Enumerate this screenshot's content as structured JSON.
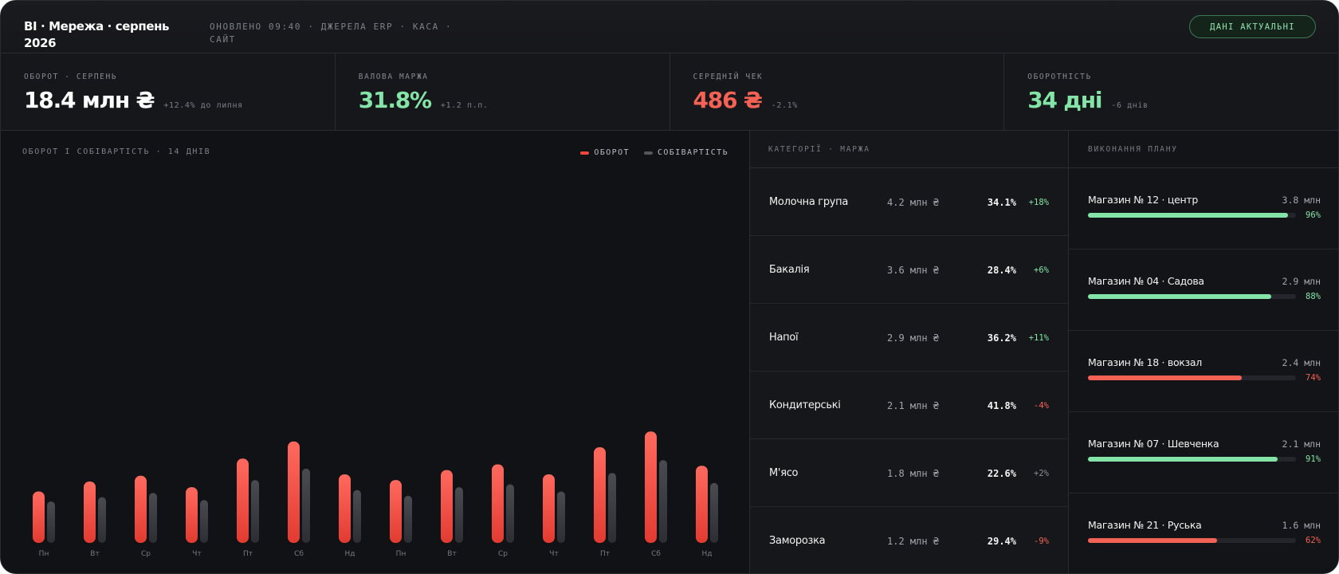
{
  "header": {
    "title": "BI · Мережа · серпень 2026",
    "updated": "ОНОВЛЕНО 09:40 · ДЖЕРЕЛА ERP · КАСА · САЙТ",
    "status": "ДАНІ АКТУАЛЬНІ"
  },
  "kpis": [
    {
      "label": "ОБОРОТ · СЕРПЕНЬ",
      "value": "18.4 млн ₴",
      "delta": "+12.4% до липня",
      "tone": "white"
    },
    {
      "label": "ВАЛОВА МАРЖА",
      "value": "31.8%",
      "delta": "+1.2 п.п.",
      "tone": "green"
    },
    {
      "label": "СЕРЕДНІЙ ЧЕК",
      "value": "486 ₴",
      "delta": "-2.1%",
      "tone": "red"
    },
    {
      "label": "ОБОРОТНІСТЬ",
      "value": "34 дні",
      "delta": "-6 днів",
      "tone": "green"
    }
  ],
  "chart": {
    "title": "ОБОРОТ І СОБІВАРТІСТЬ · 14 ДНІВ",
    "legend": {
      "revenue": "ОБОРОТ",
      "cost": "СОБІВАРТІСТЬ"
    }
  },
  "chart_data": {
    "type": "bar",
    "categories": [
      "Пн",
      "Вт",
      "Ср",
      "Чт",
      "Пт",
      "Сб",
      "Нд",
      "Пн",
      "Вт",
      "Ср",
      "Чт",
      "Пт",
      "Сб",
      "Нд"
    ],
    "series": [
      {
        "name": "ОБОРОТ",
        "color": "#f0473c",
        "values": [
          36,
          43,
          47,
          39,
          59,
          71,
          48,
          44,
          51,
          55,
          48,
          67,
          78,
          54
        ]
      },
      {
        "name": "СОБІВАРТІСТЬ",
        "color": "#3a3b40",
        "values": [
          29,
          32,
          35,
          30,
          44,
          52,
          37,
          33,
          39,
          41,
          36,
          49,
          58,
          42
        ]
      }
    ],
    "ylim": [
      0,
      240
    ],
    "grid": false,
    "legend_position": "top-right"
  },
  "categories": {
    "title": "КАТЕГОРІЇ · МАРЖА",
    "rows": [
      {
        "name": "Молочна група",
        "revenue": "4.2 млн ₴",
        "margin": "34.1%",
        "delta": "+18%",
        "tone": "green"
      },
      {
        "name": "Бакалія",
        "revenue": "3.6 млн ₴",
        "margin": "28.4%",
        "delta": "+6%",
        "tone": "green"
      },
      {
        "name": "Напої",
        "revenue": "2.9 млн ₴",
        "margin": "36.2%",
        "delta": "+11%",
        "tone": "green"
      },
      {
        "name": "Кондитерські",
        "revenue": "2.1 млн ₴",
        "margin": "41.8%",
        "delta": "-4%",
        "tone": "red"
      },
      {
        "name": "М'ясо",
        "revenue": "1.8 млн ₴",
        "margin": "22.6%",
        "delta": "+2%",
        "tone": "gray"
      },
      {
        "name": "Заморозка",
        "revenue": "1.2 млн ₴",
        "margin": "29.4%",
        "delta": "-9%",
        "tone": "red"
      }
    ]
  },
  "plan": {
    "title": "ВИКОНАННЯ ПЛАНУ",
    "rows": [
      {
        "name": "Магазин № 12 · центр",
        "revenue": "3.8 млн",
        "pct": "96%",
        "fill": 0.96,
        "tone": "green"
      },
      {
        "name": "Магазин № 04 · Садова",
        "revenue": "2.9 млн",
        "pct": "88%",
        "fill": 0.88,
        "tone": "green"
      },
      {
        "name": "Магазин № 18 · вокзал",
        "revenue": "2.4 млн",
        "pct": "74%",
        "fill": 0.74,
        "tone": "red"
      },
      {
        "name": "Магазин № 07 · Шевченка",
        "revenue": "2.1 млн",
        "pct": "91%",
        "fill": 0.91,
        "tone": "green"
      },
      {
        "name": "Магазин № 21 · Руська",
        "revenue": "1.6 млн",
        "pct": "62%",
        "fill": 0.62,
        "tone": "red"
      }
    ]
  },
  "colors": {
    "green": "#84e3a6",
    "red": "#f46255",
    "gray": "#8a8d95",
    "white": "#ffffff"
  }
}
